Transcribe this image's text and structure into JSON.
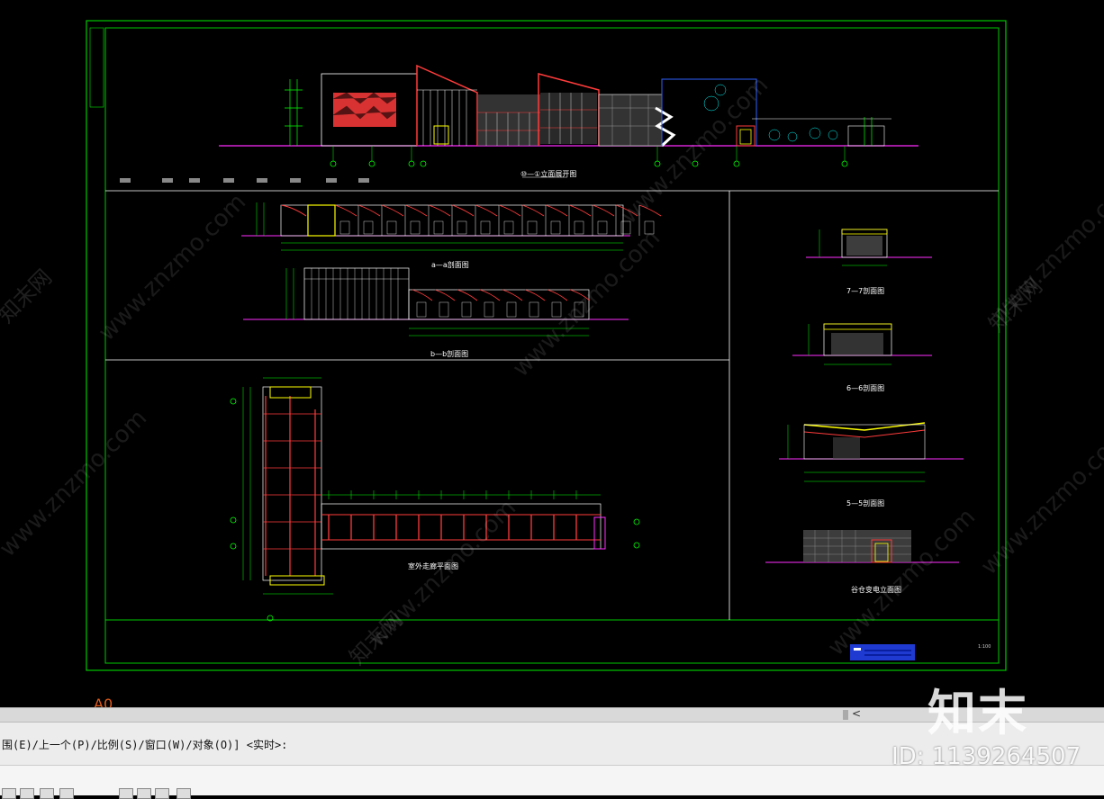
{
  "colors": {
    "frame": "#00c800",
    "ground": "#ff2bff",
    "dim": "#00ff00",
    "wall": "#ffffff",
    "roof_red": "#ff3b3b",
    "glass": "#00ffff",
    "yellow": "#ffff00",
    "blue": "#3060ff",
    "layout_tab": "#e05a1a"
  },
  "drawing": {
    "titles": {
      "elevation_main": "⑩—①立面展开图",
      "section_a": "a—a剖面图",
      "section_b": "b—b剖面图",
      "plan": "室外走廊平面图",
      "section_7": "7—7剖面图",
      "section_6": "6—6剖面图",
      "section_5": "5—5剖面图",
      "elevation_small": "谷仓变电立面图"
    },
    "scale_note": "1:100",
    "layout_tab": "A0"
  },
  "command_line": {
    "text": "围(E)/上一个(P)/比例(S)/窗口(W)/对象(O)] <实时>:"
  },
  "watermark": {
    "logo": "知末",
    "id": "ID: 1139264507",
    "site": "www.znzmo.com",
    "site_short": "知末网"
  },
  "scrollbar": {
    "arrow": "<"
  }
}
